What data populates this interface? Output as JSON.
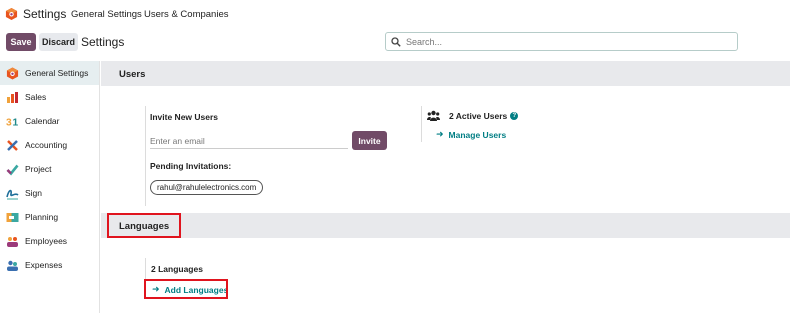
{
  "topbar": {
    "app_title": "Settings",
    "nav": [
      "General Settings",
      "Users & Companies"
    ]
  },
  "controls": {
    "save_label": "Save",
    "discard_label": "Discard",
    "page_title": "Settings",
    "search_placeholder": "Search..."
  },
  "sidebar": {
    "items": [
      {
        "label": "General Settings",
        "icon": "odoo-logo-icon",
        "active": true
      },
      {
        "label": "Sales",
        "icon": "sales-chart-icon"
      },
      {
        "label": "Calendar",
        "icon": "calendar-31-icon"
      },
      {
        "label": "Accounting",
        "icon": "accounting-icon"
      },
      {
        "label": "Project",
        "icon": "project-check-icon"
      },
      {
        "label": "Sign",
        "icon": "sign-signature-icon"
      },
      {
        "label": "Planning",
        "icon": "planning-icon"
      },
      {
        "label": "Employees",
        "icon": "employees-icon"
      },
      {
        "label": "Expenses",
        "icon": "expenses-icon"
      }
    ]
  },
  "users": {
    "section_title": "Users",
    "invite_title": "Invite New Users",
    "email_placeholder": "Enter an email",
    "invite_label": "Invite",
    "pending_title": "Pending Invitations:",
    "pending_email": "rahul@rahulelectronics.com",
    "active_users": "2 Active Users",
    "manage_users": "Manage Users"
  },
  "languages": {
    "section_title": "Languages",
    "count": "2 Languages",
    "add_label": "Add Languages"
  },
  "colors": {
    "primary": "#714b67",
    "link": "#017e84",
    "highlight": "#e0141e"
  }
}
